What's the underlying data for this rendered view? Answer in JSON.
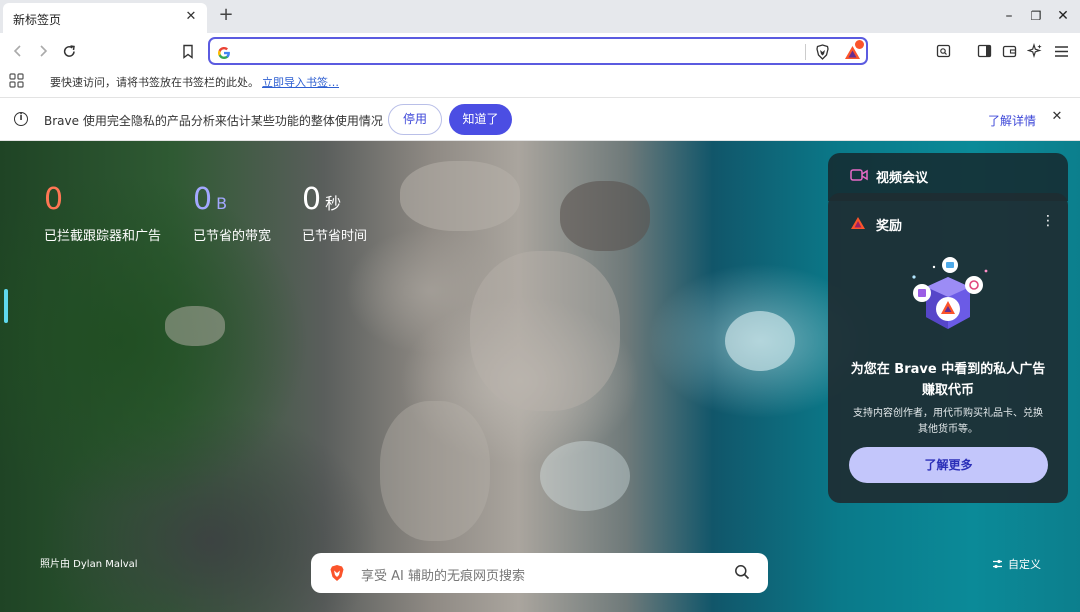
{
  "tab": {
    "title": "新标签页"
  },
  "newtab_symbol": "+",
  "window": {
    "minimize": "–",
    "restore": "❐",
    "close": "✕"
  },
  "bookmarks": {
    "hint": "要快速访问，请将书签放在书签栏的此处。",
    "import_link": "立即导入书签…"
  },
  "infobar": {
    "message": "Brave 使用完全隐私的产品分析来估计某些功能的整体使用情况",
    "disable_label": "停用",
    "ok_label": "知道了",
    "learn_more_label": "了解详情",
    "close_symbol": "✕"
  },
  "stats": {
    "trackers": {
      "value": "0",
      "unit": "",
      "label": "已拦截跟踪器和广告",
      "color": "#ff7654"
    },
    "bandwidth": {
      "value": "0",
      "unit": "B",
      "label": "已节省的带宽",
      "color": "#a3a8ff"
    },
    "time": {
      "value": "0",
      "unit": "秒",
      "label": "已节省时间",
      "color": "#ffffff"
    }
  },
  "photo_credit": "照片由 Dylan Malval",
  "search": {
    "placeholder": "享受 AI 辅助的无痕网页搜索"
  },
  "customize_label": "自定义",
  "widgets": {
    "video": {
      "title": "视频会议"
    },
    "rewards": {
      "title": "奖励",
      "headline_line1": "为您在 Brave 中看到的私人广告",
      "headline_line2": "赚取代币",
      "desc_line1": "支持内容创作者，用代币购买礼品卡、兑换",
      "desc_line2": "其他货币等。",
      "button_label": "了解更多"
    }
  },
  "colors": {
    "accent": "#4b4ee3",
    "brave_orange": "#fb542b",
    "omnibox_border": "#5b5be0"
  },
  "icons": [
    "back-icon",
    "forward-icon",
    "reload-icon",
    "bookmark-icon",
    "google-icon",
    "brave-shields-icon",
    "brave-rewards-icon",
    "screenshot-icon",
    "sidebar-icon",
    "wallet-icon",
    "leo-ai-icon",
    "menu-icon"
  ]
}
